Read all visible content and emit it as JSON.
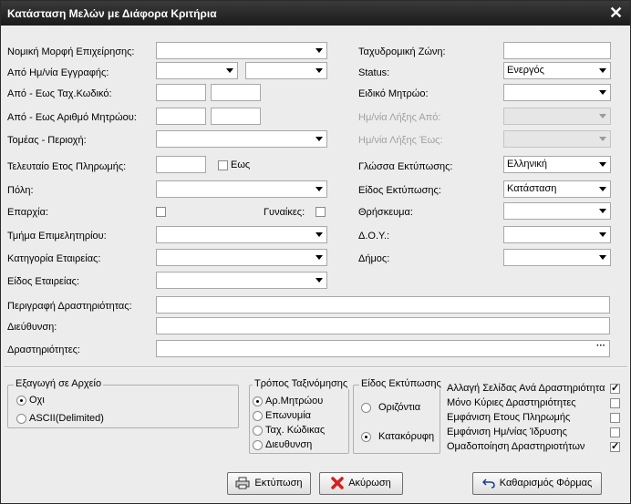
{
  "window": {
    "title": "Κατάσταση Μελών με Διάφορα Κριτήρια",
    "close_symbol": "✕"
  },
  "left": {
    "legal_form_label": "Νομική Μορφή Επιχείρησης:",
    "reg_date_label": "Από Ημ/νία Εγγραφής:",
    "postcode_range_label": "Από - Εως Ταχ.Κωδικό:",
    "regnum_range_label": "Από - Εως Αριθμό Μητρώου:",
    "sector_label": "Τομέας - Περιοχή:",
    "last_payment_year_label": "Τελευταίο Ετος Πληρωμής:",
    "until_label": "Εως",
    "city_label": "Πόλη:",
    "province_label": "Επαρχία:",
    "women_label": "Γυναίκες:",
    "chamber_dept_label": "Τμήμα Επιμελητηρίου:",
    "company_category_label": "Κατηγορία Εταιρείας:",
    "company_type_label": "Είδος Εταιρείας:"
  },
  "right": {
    "postal_zone_label": "Ταχυδρομική Ζώνη:",
    "status_label": "Status:",
    "status_value": "Ενεργός",
    "special_registry_label": "Ειδικό Μητρώο:",
    "expiry_from_label": "Ημ/νία Λήξης Από:",
    "expiry_to_label": "Ημ/νία Λήξης Έως:",
    "print_language_label": "Γλώσσα Εκτύπωσης:",
    "print_language_value": "Ελληνική",
    "print_type_label": "Είδος Εκτύπωσης:",
    "print_type_value": "Κατάσταση",
    "religion_label": "Θρήσκευμα:",
    "tax_office_label": "Δ.Ο.Υ.:",
    "municipality_label": "Δήμος:"
  },
  "wide": {
    "activity_description_label": "Περιγραφή Δραστηριότητας:",
    "address_label": "Διεύθυνση:",
    "activities_label": "Δραστηριότητες:",
    "ellipsis": "···"
  },
  "export": {
    "title": "Εξαγωγή σε Αρχείο",
    "options": [
      "Οχι",
      "ASCII(Delimited)"
    ]
  },
  "sort": {
    "title": "Τρόπος Ταξινόμησης",
    "options": [
      "Αρ.Μητρώου",
      "Επωνυμία",
      "Ταχ. Κώδικας",
      "Διευθυνση"
    ]
  },
  "print_kind": {
    "title": "Είδος Εκτύπωσης",
    "options": [
      "Οριζόντια",
      "Κατακόρυφη"
    ]
  },
  "options": {
    "items": [
      {
        "label": "Αλλαγή Σελίδας Ανά Δραστηριότητα",
        "checked": true
      },
      {
        "label": "Μόνο Κύριες Δραστηριότητες",
        "checked": false
      },
      {
        "label": "Εμφάνιση Ετους Πληρωμής",
        "checked": false
      },
      {
        "label": "Εμφάνιση Ημ/νίας Ίδρυσης",
        "checked": false
      },
      {
        "label": "Ομαδοποίηση Δραστηριοτήτων",
        "checked": true
      }
    ]
  },
  "buttons": {
    "print": "Εκτύπωση",
    "cancel": "Ακύρωση",
    "clear": "Καθαρισμός Φόρμας"
  }
}
